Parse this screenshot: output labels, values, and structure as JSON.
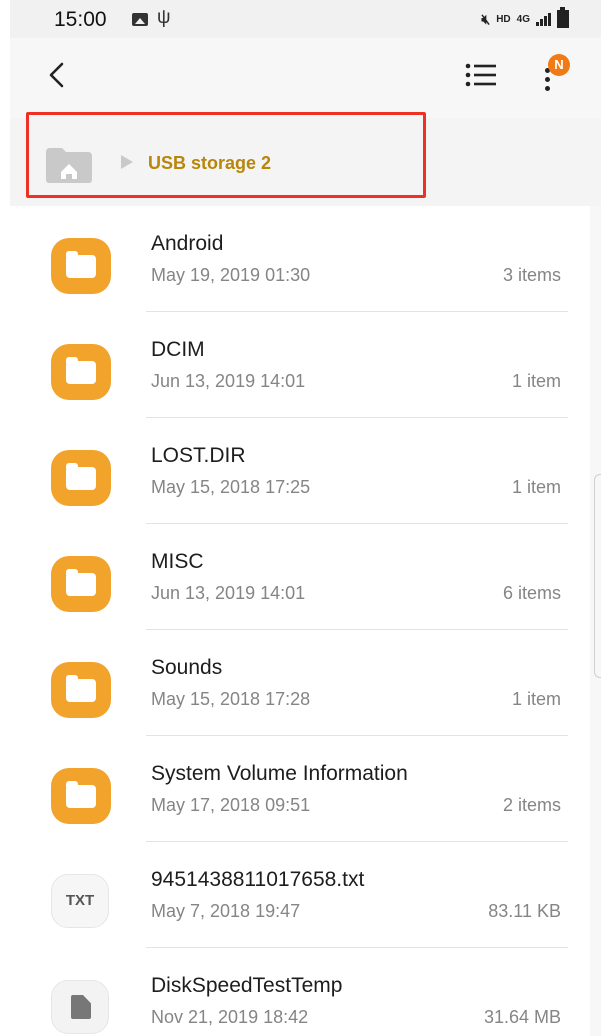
{
  "status_bar": {
    "time": "15:00",
    "hd": "HD",
    "network": "4G"
  },
  "app_bar": {
    "badge": "N"
  },
  "breadcrumb": {
    "current": "USB storage 2"
  },
  "files": [
    {
      "name": "Android",
      "date": "May 19, 2019 01:30",
      "meta": "3 items",
      "icon": "folder-icon"
    },
    {
      "name": "DCIM",
      "date": "Jun 13, 2019 14:01",
      "meta": "1 item",
      "icon": "folder-icon"
    },
    {
      "name": "LOST.DIR",
      "date": "May 15, 2018 17:25",
      "meta": "1 item",
      "icon": "folder-icon"
    },
    {
      "name": "MISC",
      "date": "Jun 13, 2019 14:01",
      "meta": "6 items",
      "icon": "folder-icon"
    },
    {
      "name": "Sounds",
      "date": "May 15, 2018 17:28",
      "meta": "1 item",
      "icon": "folder-icon"
    },
    {
      "name": "System Volume Information",
      "date": "May 17, 2018 09:51",
      "meta": "2 items",
      "icon": "folder-icon"
    },
    {
      "name": "9451438811017658.txt",
      "date": "May 7, 2018 19:47",
      "meta": "83.11 KB",
      "icon": "txt-file-icon",
      "icon_label": "TXT"
    },
    {
      "name": "DiskSpeedTestTemp",
      "date": "Nov 21, 2019 18:42",
      "meta": "31.64 MB",
      "icon": "file-icon"
    }
  ],
  "colors": {
    "folder": "#f2a32c",
    "breadcrumb_text": "#b8860b",
    "highlight": "#ee3124",
    "badge": "#f07b16"
  }
}
